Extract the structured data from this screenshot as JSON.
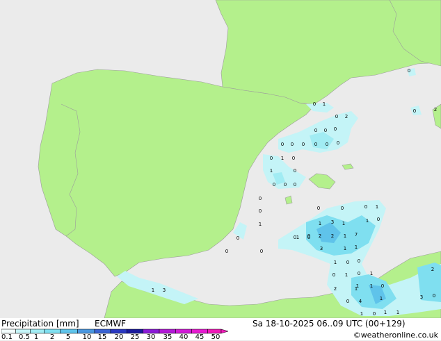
{
  "legend": {
    "title": "Precipitation [mm]",
    "model": "ECMWF",
    "datetime": "Sa 18-10-2025 06..09 UTC (00+129)",
    "credit": "©weatheronline.co.uk",
    "bins": [
      {
        "label": "0.1",
        "color": "#f2fdfd"
      },
      {
        "label": "0.5",
        "color": "#c4f4f7"
      },
      {
        "label": "1",
        "color": "#a1ecf3"
      },
      {
        "label": "2",
        "color": "#7fdff0"
      },
      {
        "label": "5",
        "color": "#5fc3ea"
      },
      {
        "label": "10",
        "color": "#4a97e0"
      },
      {
        "label": "15",
        "color": "#3a63d2"
      },
      {
        "label": "20",
        "color": "#2a38bf"
      },
      {
        "label": "25",
        "color": "#1a1a9c"
      },
      {
        "label": "30",
        "color": "#8a1ad6"
      },
      {
        "label": "35",
        "color": "#b21ad6"
      },
      {
        "label": "40",
        "color": "#d11ad6"
      },
      {
        "label": "45",
        "color": "#e61ad0"
      },
      {
        "label": "50",
        "color": "#f01ab8"
      }
    ]
  },
  "colors": {
    "sea": "#ebebeb",
    "land": "#b4f08c",
    "border": "#9c9c9c",
    "precip_light": "#c4f4f7",
    "precip_medium": "#7fdff0",
    "precip_heavy": "#5fc3ea"
  },
  "map_labels": [
    {
      "text": "0"
    },
    {
      "text": "1"
    },
    {
      "text": "0"
    },
    {
      "text": "2"
    },
    {
      "text": "0"
    },
    {
      "text": "0"
    },
    {
      "text": "0"
    },
    {
      "text": "0"
    },
    {
      "text": "0"
    },
    {
      "text": "0"
    },
    {
      "text": "0"
    },
    {
      "text": "0"
    },
    {
      "text": "0"
    },
    {
      "text": "0"
    },
    {
      "text": "1"
    },
    {
      "text": "0"
    },
    {
      "text": "1"
    },
    {
      "text": "0"
    },
    {
      "text": "0"
    },
    {
      "text": "0"
    },
    {
      "text": "0"
    },
    {
      "text": "0"
    },
    {
      "text": "0"
    },
    {
      "text": "0"
    },
    {
      "text": "0"
    },
    {
      "text": "0"
    },
    {
      "text": "1"
    },
    {
      "text": "1"
    },
    {
      "text": "0"
    },
    {
      "text": "0"
    },
    {
      "text": "0"
    },
    {
      "text": "1"
    },
    {
      "text": "3"
    },
    {
      "text": "1"
    },
    {
      "text": "1"
    },
    {
      "text": "0"
    },
    {
      "text": "1"
    },
    {
      "text": "0"
    },
    {
      "text": "2"
    },
    {
      "text": "2"
    },
    {
      "text": "1"
    },
    {
      "text": "7"
    },
    {
      "text": "3"
    },
    {
      "text": "1"
    },
    {
      "text": "1"
    },
    {
      "text": "1"
    },
    {
      "text": "0"
    },
    {
      "text": "0"
    },
    {
      "text": "0"
    },
    {
      "text": "1"
    },
    {
      "text": "0"
    },
    {
      "text": "1"
    },
    {
      "text": "2"
    },
    {
      "text": "1"
    },
    {
      "text": "1"
    },
    {
      "text": "0"
    },
    {
      "text": "0"
    },
    {
      "text": "4"
    },
    {
      "text": "1"
    },
    {
      "text": "3"
    },
    {
      "text": "0"
    },
    {
      "text": "2"
    },
    {
      "text": "1"
    },
    {
      "text": "0"
    },
    {
      "text": "1"
    },
    {
      "text": "1"
    },
    {
      "text": "0"
    },
    {
      "text": "0"
    },
    {
      "text": "2"
    },
    {
      "text": "1"
    },
    {
      "text": "3"
    },
    {
      "text": "0"
    },
    {
      "text": "0"
    },
    {
      "text": "1"
    }
  ]
}
